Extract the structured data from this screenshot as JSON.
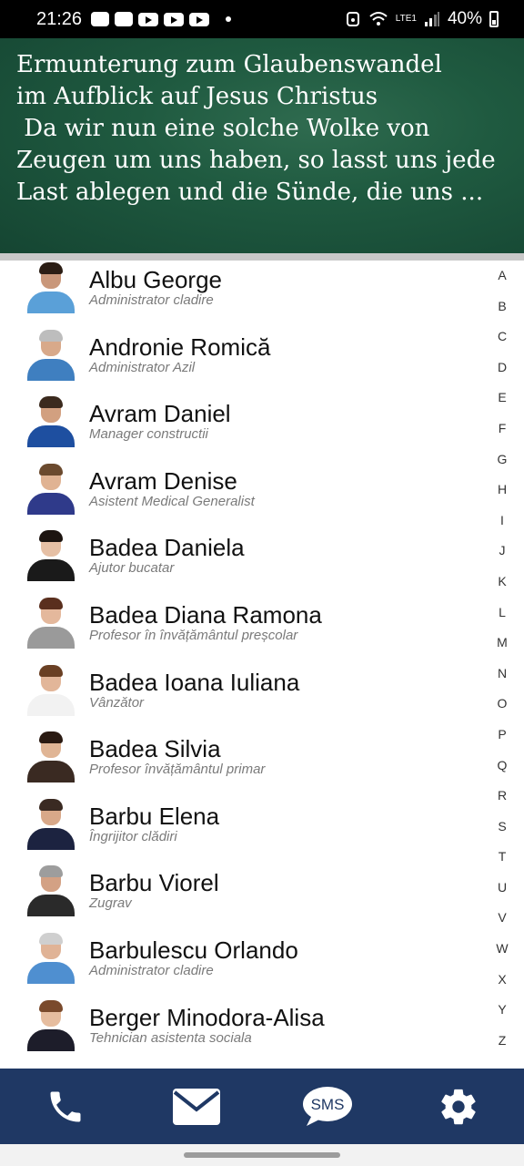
{
  "status": {
    "time": "21:26",
    "battery": "40%",
    "network": "LTE1"
  },
  "banner": {
    "text": "Ermunterung zum Glaubenswandel\nim Aufblick auf Jesus Christus\n Da wir nun eine solche Wolke von\nZeugen um uns haben, so lasst uns jede\nLast ablegen und die Sünde, die uns ..."
  },
  "contacts": [
    {
      "name": "Albu George",
      "role": "Administrator cladire"
    },
    {
      "name": "Andronie Romică",
      "role": "Administrator Azil"
    },
    {
      "name": "Avram Daniel",
      "role": "Manager constructii"
    },
    {
      "name": "Avram Denise",
      "role": "Asistent Medical Generalist"
    },
    {
      "name": "Badea Daniela",
      "role": "Ajutor bucatar"
    },
    {
      "name": "Badea Diana Ramona",
      "role": "Profesor în învățământul preșcolar"
    },
    {
      "name": "Badea Ioana Iuliana",
      "role": "Vânzător"
    },
    {
      "name": "Badea Silvia",
      "role": "Profesor învățământul primar"
    },
    {
      "name": "Barbu Elena",
      "role": "Îngrijitor clădiri"
    },
    {
      "name": "Barbu Viorel",
      "role": "Zugrav"
    },
    {
      "name": "Barbulescu Orlando",
      "role": "Administrator cladire"
    },
    {
      "name": "Berger Minodora-Alisa",
      "role": "Tehnician asistenta sociala"
    }
  ],
  "alphabet": [
    "A",
    "B",
    "C",
    "D",
    "E",
    "F",
    "G",
    "H",
    "I",
    "J",
    "K",
    "L",
    "M",
    "N",
    "O",
    "P",
    "Q",
    "R",
    "S",
    "T",
    "U",
    "V",
    "W",
    "X",
    "Y",
    "Z"
  ],
  "bottom_bar": {
    "sms_label": "SMS",
    "color": "#1f3864"
  }
}
